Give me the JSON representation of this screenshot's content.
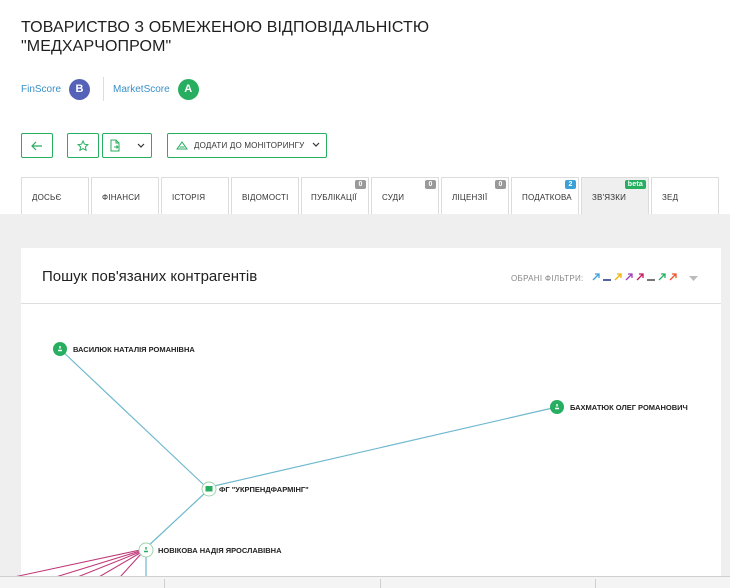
{
  "company": {
    "title": "ТОВАРИСТВО З ОБМЕЖЕНОЮ ВІДПОВІДАЛЬНІСТЮ \"МЕДХАРЧОПРОМ\""
  },
  "scores": {
    "finscore_label": "FinScore",
    "finscore_value": "B",
    "finscore_color": "#5463b8",
    "marketscore_label": "MarketScore",
    "marketscore_value": "A",
    "marketscore_color": "#27ae60"
  },
  "toolbar": {
    "back_icon": "arrow-left-icon",
    "favorite_icon": "star-icon",
    "export_icon": "document-export-icon",
    "monitor_label": "ДОДАТИ ДО МОНІТОРИНГУ",
    "accent": "#27ae60"
  },
  "tabs": [
    {
      "label": "ДОСЬЄ",
      "badge": ""
    },
    {
      "label": "ФІНАНСИ",
      "badge": ""
    },
    {
      "label": "ІСТОРІЯ",
      "badge": ""
    },
    {
      "label": "ВІДОМОСТІ",
      "badge": ""
    },
    {
      "label": "ПУБЛІКАЦІЇ",
      "badge": "0"
    },
    {
      "label": "СУДИ",
      "badge": "0"
    },
    {
      "label": "ЛІЦЕНЗІЇ",
      "badge": "0"
    },
    {
      "label": "ПОДАТКОВА",
      "badge": "2"
    },
    {
      "label": "ЗВ'ЯЗКИ",
      "badge": "beta",
      "active": true
    },
    {
      "label": "ЗЕД",
      "badge": ""
    }
  ],
  "relations": {
    "title": "Пошук пов'язаних контрагентів",
    "filters_label": "ОБРАНІ ФІЛЬТРИ:",
    "filter_colors": [
      "#3aa0d8",
      "#2c3e90",
      "#f0b400",
      "#9b3fb5",
      "#c2185b",
      "#555555",
      "#27ae60",
      "#e8552c"
    ],
    "nodes": [
      {
        "label": "ВАСИЛЮК НАТАЛІЯ РОМАНІВНА",
        "type": "person"
      },
      {
        "label": "БАХМАТЮК ОЛЕГ РОМАНОВИЧ",
        "type": "person"
      },
      {
        "label": "ФГ \"УКРПЕНДФАРМІНГ\"",
        "type": "company"
      },
      {
        "label": "НОВІКОВА НАДІЯ ЯРОСЛАВІВНА",
        "type": "person"
      }
    ],
    "edge_colors": {
      "link": "#6fb8cf",
      "pink": "#c0397a"
    }
  }
}
